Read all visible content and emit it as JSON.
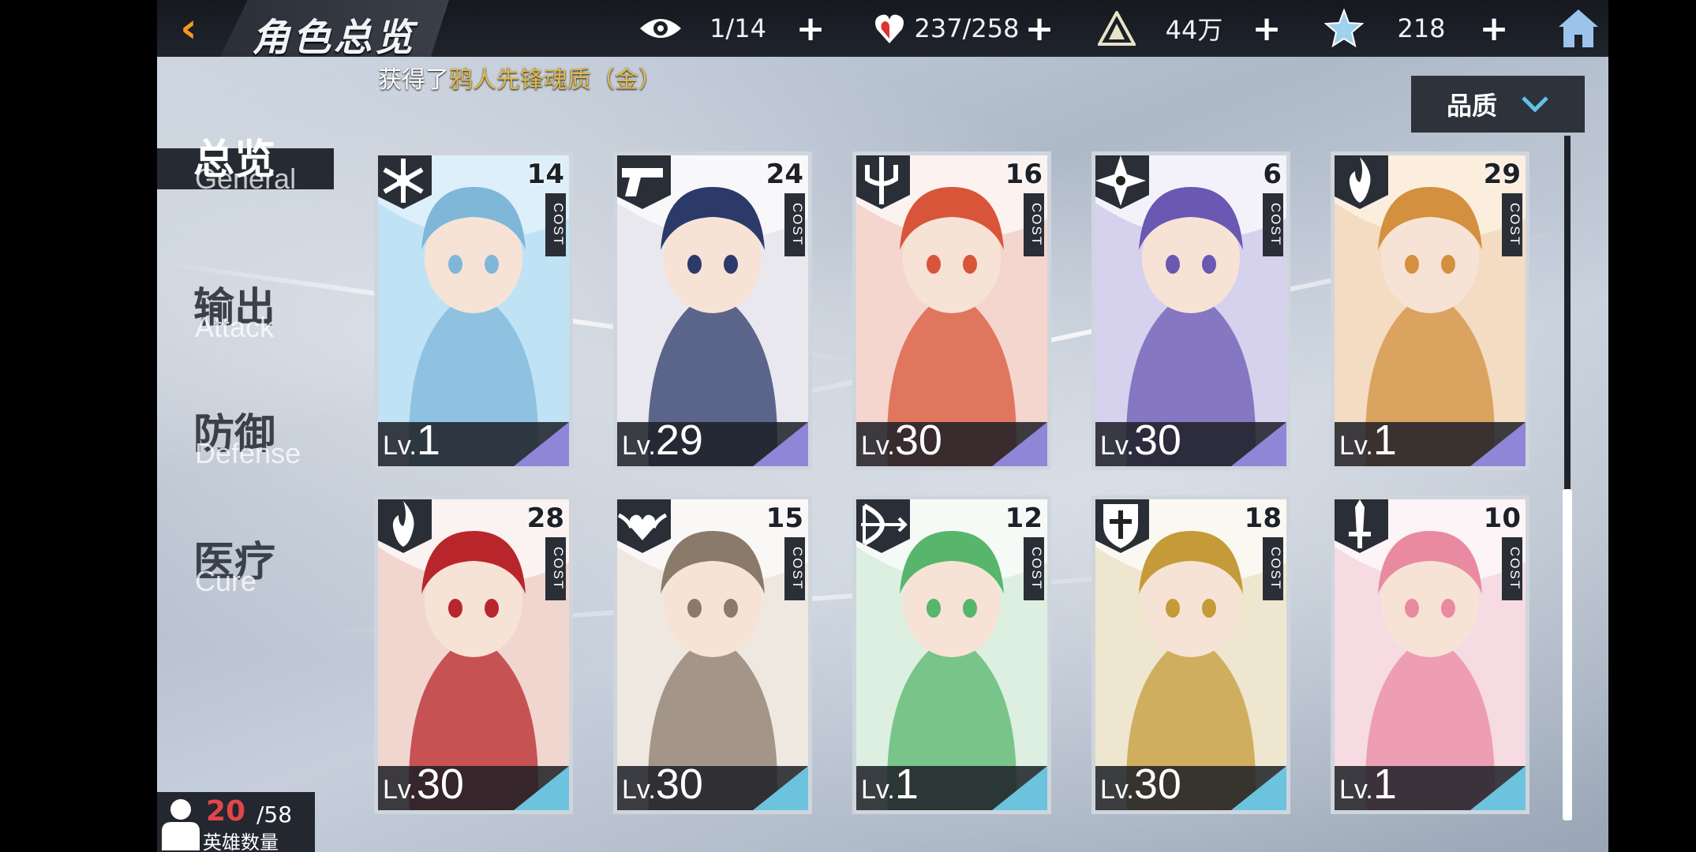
{
  "header": {
    "back_icon": "chevron-left-icon",
    "title": "角色总览",
    "resources": [
      {
        "icon": "eye-icon",
        "value": "1/14"
      },
      {
        "icon": "heart-hand-icon",
        "value": "237/258"
      },
      {
        "icon": "triangle-emblem-icon",
        "value": "44万"
      },
      {
        "icon": "star-badge-icon",
        "value": "218"
      }
    ],
    "home_icon": "home-icon"
  },
  "notice": {
    "prefix": "获得了",
    "item": "鸦人先锋魂质（金）"
  },
  "filter": {
    "label": "品质",
    "icon": "chevron-down-icon"
  },
  "nav": [
    {
      "zh": "总览",
      "en": "General",
      "active": true
    },
    {
      "zh": "输出",
      "en": "Attack",
      "active": false
    },
    {
      "zh": "防御",
      "en": "Defense",
      "active": false
    },
    {
      "zh": "医疗",
      "en": "Cure",
      "active": false
    }
  ],
  "cards": [
    {
      "cost": "14",
      "cost_label": "COST",
      "lv_prefix": "Lv.",
      "level": "1",
      "class_icon": "snowflake-icon",
      "rarity_color": "#8f86d8"
    },
    {
      "cost": "24",
      "cost_label": "COST",
      "lv_prefix": "Lv.",
      "level": "29",
      "class_icon": "pistol-icon",
      "rarity_color": "#8f86d8"
    },
    {
      "cost": "16",
      "cost_label": "COST",
      "lv_prefix": "Lv.",
      "level": "30",
      "class_icon": "trident-icon",
      "rarity_color": "#8f86d8"
    },
    {
      "cost": "6",
      "cost_label": "COST",
      "lv_prefix": "Lv.",
      "level": "30",
      "class_icon": "shuriken-icon",
      "rarity_color": "#8f86d8"
    },
    {
      "cost": "29",
      "cost_label": "COST",
      "lv_prefix": "Lv.",
      "level": "1",
      "class_icon": "flame-icon",
      "rarity_color": "#8f86d8"
    },
    {
      "cost": "28",
      "cost_label": "COST",
      "lv_prefix": "Lv.",
      "level": "30",
      "class_icon": "flame-icon",
      "rarity_color": "#6cc3de"
    },
    {
      "cost": "15",
      "cost_label": "COST",
      "lv_prefix": "Lv.",
      "level": "30",
      "class_icon": "winged-heart-icon",
      "rarity_color": "#6cc3de"
    },
    {
      "cost": "12",
      "cost_label": "COST",
      "lv_prefix": "Lv.",
      "level": "1",
      "class_icon": "bow-icon",
      "rarity_color": "#6cc3de"
    },
    {
      "cost": "18",
      "cost_label": "COST",
      "lv_prefix": "Lv.",
      "level": "30",
      "class_icon": "cross-shield-icon",
      "rarity_color": "#6cc3de"
    },
    {
      "cost": "10",
      "cost_label": "COST",
      "lv_prefix": "Lv.",
      "level": "1",
      "class_icon": "sword-icon",
      "rarity_color": "#6cc3de"
    }
  ],
  "hero_count": {
    "icon": "person-icon",
    "current": "20",
    "max": "/58",
    "label": "英雄数量"
  }
}
